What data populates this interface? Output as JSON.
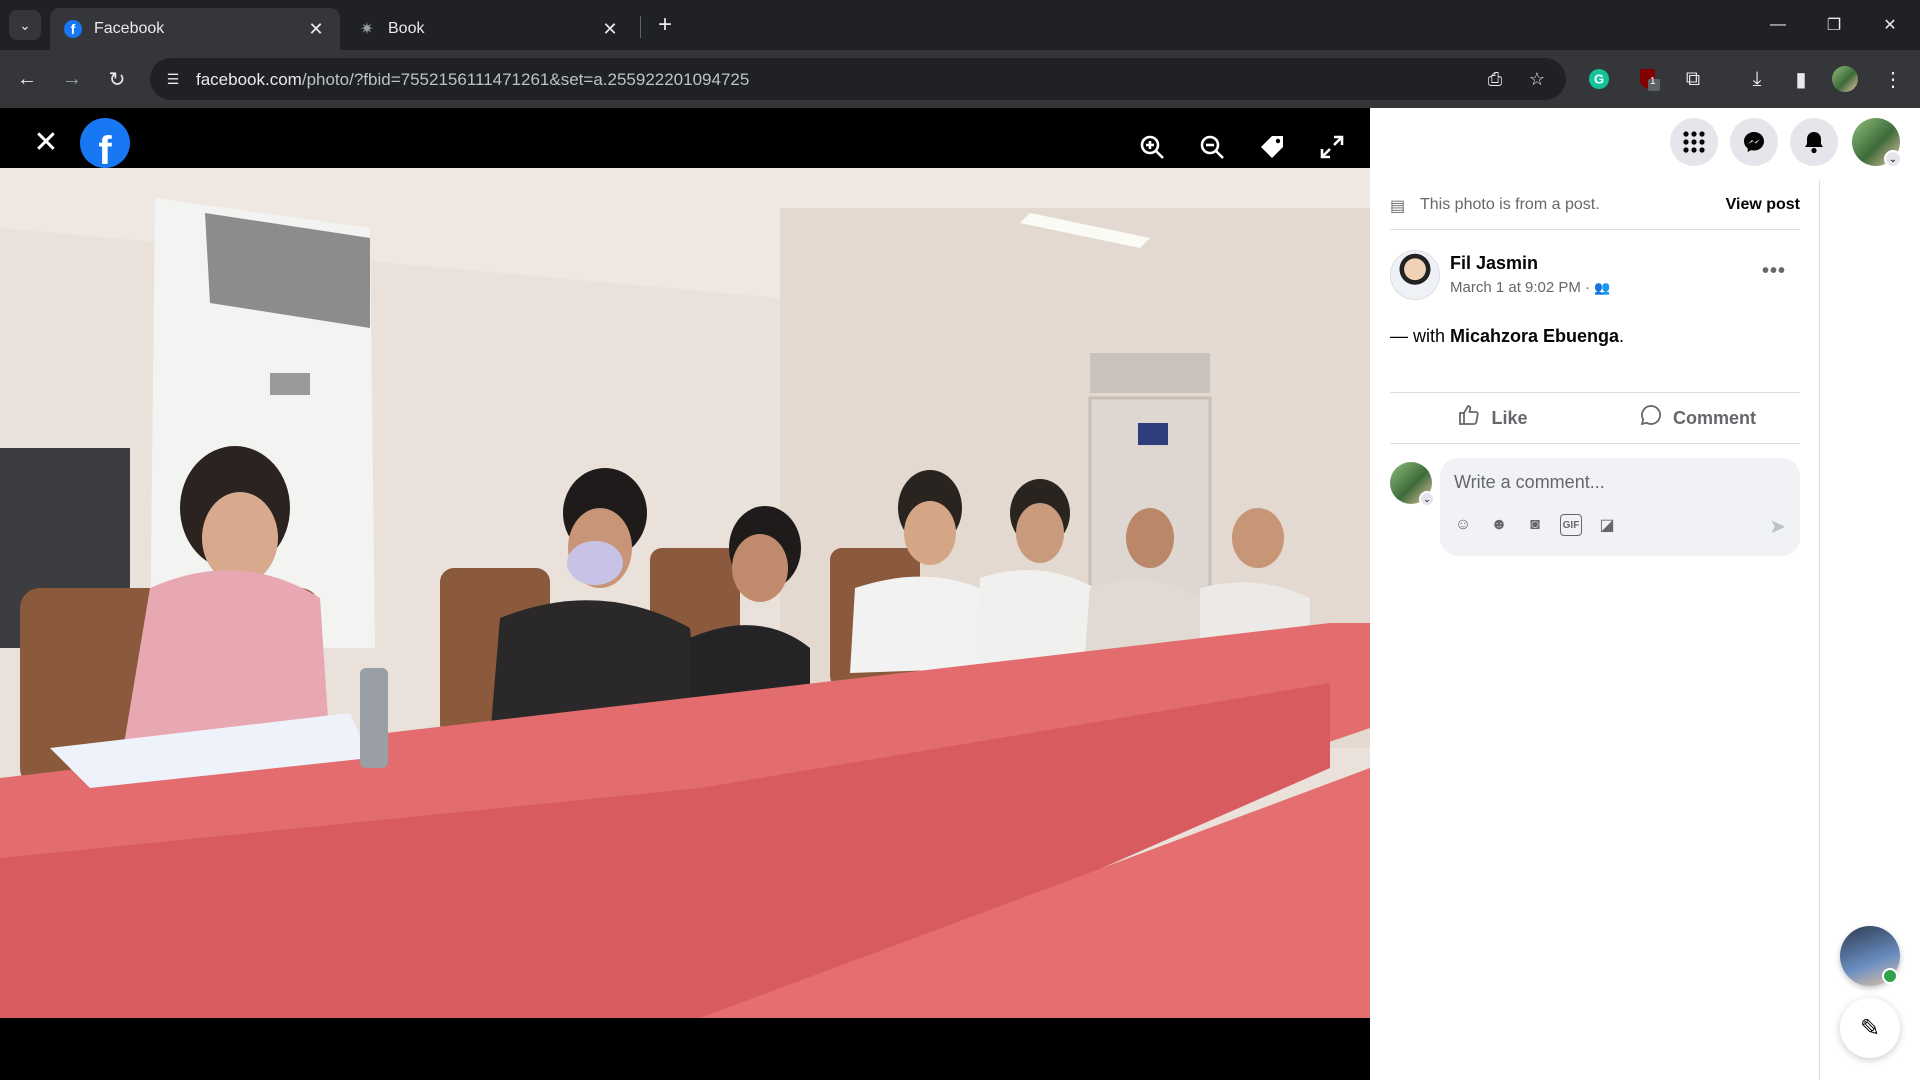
{
  "browser": {
    "tabs": [
      {
        "title": "Facebook",
        "active": true,
        "favicon": "facebook-favicon"
      },
      {
        "title": "Book",
        "active": false,
        "favicon": "book-favicon"
      }
    ],
    "url_host": "facebook.com",
    "url_path": "/photo/?fbid=7552156111471261&set=a.255922201094725",
    "extension_badge": "1"
  },
  "viewer": {
    "close_icon": "close-icon",
    "logo_letter": "f",
    "tools": [
      "zoom-in-icon",
      "zoom-out-icon",
      "tag-icon",
      "fullscreen-icon"
    ]
  },
  "panel": {
    "info_text": "This photo is from a post.",
    "view_post": "View post",
    "author_name": "Fil Jasmin",
    "post_date": "March 1 at 9:02 PM ·",
    "with_prefix": "— with ",
    "tagged_name": "Micahzora Ebuenga",
    "with_suffix": ".",
    "like_label": "Like",
    "comment_label": "Comment",
    "comment_placeholder": "Write a comment..."
  },
  "colors": {
    "facebook_blue": "#1877f2",
    "chrome_dark": "#202124",
    "chrome_toolbar": "#35363a",
    "online_green": "#31a24c"
  }
}
